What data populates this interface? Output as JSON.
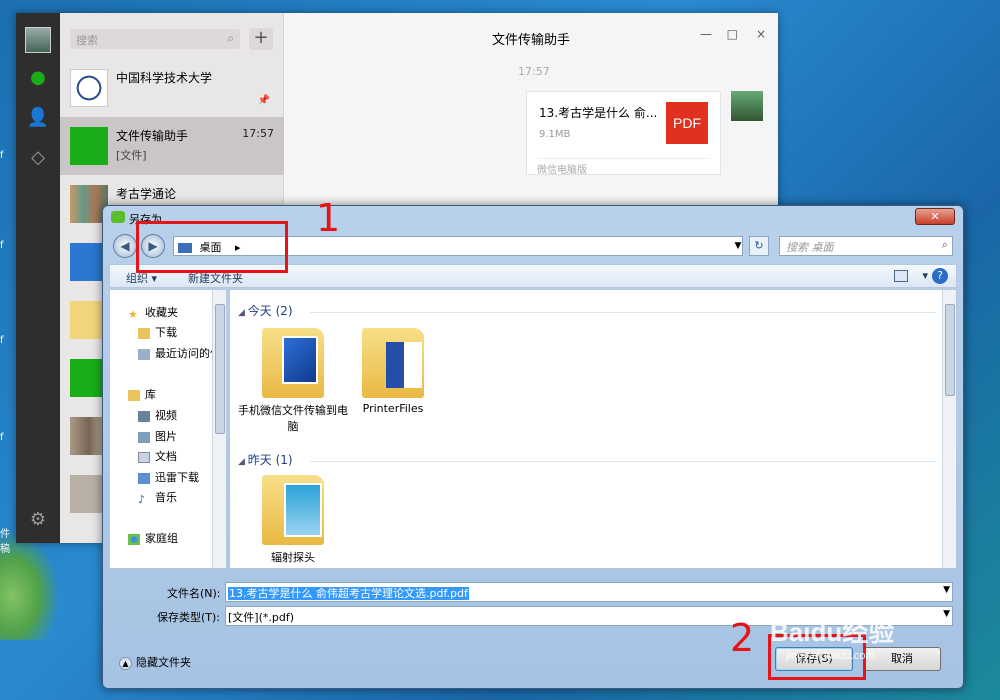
{
  "desktop": {
    "side_labels": [
      "f",
      "f",
      "f",
      "f",
      "f",
      "f",
      "件",
      "稿"
    ]
  },
  "wechat": {
    "search_placeholder": "搜索",
    "plus_label": "+",
    "chats": [
      {
        "name": "中国科学技术大学",
        "sub": "",
        "time": ""
      },
      {
        "name": "文件传输助手",
        "sub": "[文件]",
        "time": "17:57"
      },
      {
        "name": "考古学通论",
        "sub": "",
        "time": ""
      }
    ],
    "conversation_title": "文件传输助手",
    "message_time": "17:57",
    "file_message": {
      "name": "13.考古学是什么 俞...",
      "size": "9.1MB",
      "badge": "PDF",
      "source": "微信电脑版"
    },
    "window_controls": {
      "minimize": "—",
      "maximize": "□",
      "close": "×"
    }
  },
  "dialog": {
    "title": "另存为",
    "close_label": "✕",
    "address": "桌面",
    "address_arrow": "▸",
    "search_placeholder": "搜索 桌面",
    "toolbar": {
      "organize": "组织 ▾",
      "new_folder": "新建文件夹",
      "help": "?"
    },
    "nav_pane": [
      {
        "label": "收藏夹",
        "icon": "star-icon"
      },
      {
        "label": "下载",
        "icon": "download-folder-icon"
      },
      {
        "label": "最近访问的位置",
        "icon": "recent-places-icon"
      },
      {
        "label": "库",
        "icon": "library-icon"
      },
      {
        "label": "视频",
        "icon": "video-icon"
      },
      {
        "label": "图片",
        "icon": "pictures-icon"
      },
      {
        "label": "文档",
        "icon": "documents-icon"
      },
      {
        "label": "迅雷下载",
        "icon": "thunder-download-icon"
      },
      {
        "label": "音乐",
        "icon": "music-icon"
      },
      {
        "label": "家庭组",
        "icon": "homegroup-icon"
      }
    ],
    "groups": [
      {
        "header": "今天 (2)",
        "items": [
          "手机微信文件传输到电脑",
          "PrinterFiles"
        ]
      },
      {
        "header": "昨天 (1)",
        "items": [
          "辐射探头"
        ]
      }
    ],
    "filename_label": "文件名(N):",
    "filename_value": "13.考古学是什么 俞伟超考古学理论文选.pdf.pdf",
    "filetype_label": "保存类型(T):",
    "filetype_value": "[文件](*.pdf)",
    "hide_folders": "隐藏文件夹",
    "save_button": "保存(S)",
    "cancel_button": "取消"
  },
  "annotations": {
    "step1": "1",
    "step2": "2"
  },
  "watermark": {
    "brand": "Baidu经验",
    "url": "jingyan.baidu.com"
  },
  "colors": {
    "annotation_red": "#e6141a",
    "wechat_green": "#07c160",
    "pdf_red": "#e0301e",
    "selection_blue": "#3399ff"
  }
}
